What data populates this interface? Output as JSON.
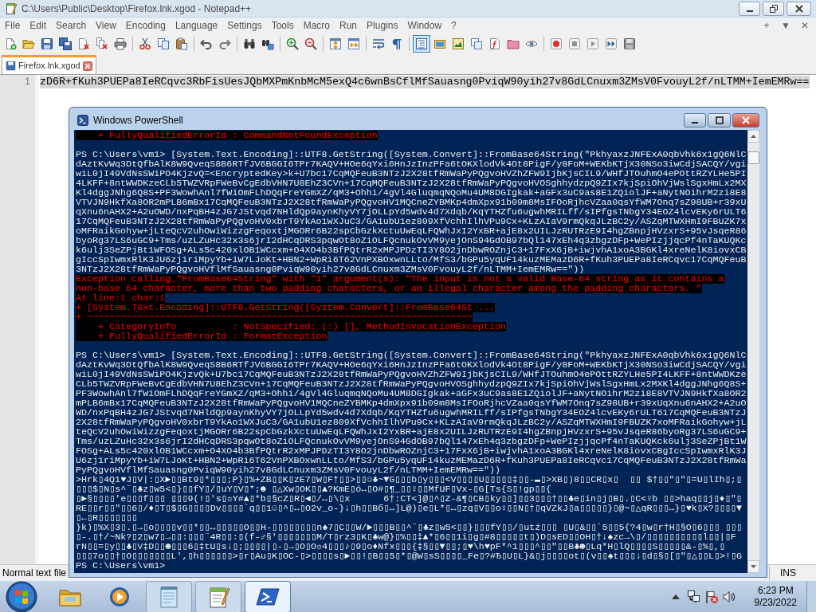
{
  "notepad": {
    "title": "C:\\Users\\Public\\Desktop\\Firefox.lnk.xgod - Notepad++",
    "menu": [
      "File",
      "Edit",
      "Search",
      "View",
      "Encoding",
      "Language",
      "Settings",
      "Tools",
      "Macro",
      "Run",
      "Plugins",
      "Window",
      "?"
    ],
    "menu_controls": [
      "+",
      "▼",
      "✕"
    ],
    "toolbar": [
      [
        {
          "kind": "new",
          "on": false
        },
        {
          "kind": "open",
          "on": false
        },
        {
          "kind": "save",
          "on": false
        },
        {
          "kind": "save_all",
          "on": false
        },
        {
          "kind": "close",
          "on": false
        },
        {
          "kind": "close_all",
          "on": false
        },
        {
          "kind": "print",
          "on": false
        }
      ],
      [
        {
          "kind": "cut",
          "on": false
        },
        {
          "kind": "copy",
          "on": false
        },
        {
          "kind": "paste",
          "on": false
        }
      ],
      [
        {
          "kind": "undo",
          "on": false
        },
        {
          "kind": "redo",
          "on": false
        }
      ],
      [
        {
          "kind": "find",
          "on": false
        },
        {
          "kind": "replace",
          "on": false
        }
      ],
      [
        {
          "kind": "zoom_in",
          "on": false
        },
        {
          "kind": "zoom_out",
          "on": false
        }
      ],
      [
        {
          "kind": "sync_vertical",
          "on": false
        },
        {
          "kind": "sync_horizontal",
          "on": false
        }
      ],
      [
        {
          "kind": "wrap",
          "on": false
        },
        {
          "kind": "show_all",
          "on": false
        }
      ],
      [
        {
          "kind": "indent_guide",
          "on": true
        },
        {
          "kind": "language",
          "on": false
        },
        {
          "kind": "doc_map",
          "on": false
        },
        {
          "kind": "doc_list",
          "on": false
        },
        {
          "kind": "function_list",
          "on": false
        },
        {
          "kind": "folder",
          "on": false
        },
        {
          "kind": "monitor",
          "on": false
        }
      ],
      [
        {
          "kind": "record",
          "on": false
        },
        {
          "kind": "stop",
          "on": false
        },
        {
          "kind": "play",
          "on": false
        },
        {
          "kind": "play_multi",
          "on": false
        },
        {
          "kind": "save_macro",
          "on": false
        }
      ]
    ],
    "tabs": [
      {
        "label": "Firefox.lnk.xgod",
        "selected": true
      }
    ],
    "lines": [
      {
        "number": "1",
        "text": "zD6R+fKuh3PUEPa8IeRCqvc3RbFisUesJQbMXPmKnbMcM5exQ4c6wnBsCflMfSauasng0PviqW90yih27v8GdLCnuxm3ZMsV0FvouyL2f/nLTMM+IemEMRw==",
        "selected": true
      }
    ],
    "status_bar": [
      "Normal text file",
      "INS"
    ]
  },
  "powershell": {
    "title": "Windows PowerShell",
    "lines": [
      {
        "kind": "error",
        "text": "    + FullyQualifiedErrorId : CommandNotFoundException"
      },
      {
        "kind": "blank"
      },
      {
        "kind": "output",
        "text": "PS C:\\Users\\vm1> [System.Text.Encoding]::UTF8.GetString([System.Convert]::FromBase64String(\"PkhyaxzJNFExA0qbVhk6x1gQ6NlC"
      },
      {
        "kind": "output",
        "text": "dAztKvWq3DtQfbAlK8W9QveqS8B6RTfJV6BGGI6TPr7KAQV+HOe6qYxi6HnJzInzPFa6tOKXlodVk4Ot8PigF/y8FoM+WEKbKTjX30NSo3iwCdjSACQY/vgi"
      },
      {
        "kind": "output",
        "text": "wiL0jI49VdNsSWiPO4KjzvQ=<EncryptedKey>k+U7bc17CqMQFeuB3NTzJ2X28tfRmWaPyPQgvoHVZhZFW9IjbKjsCIL9/WHfJTOuhmO4ePOttRZYLHe5PI"
      },
      {
        "kind": "output",
        "text": "4LKFF+8ntWWDKzeCLb5TWZVRpFWeBvCgEdbVHN7U8EhZ3CVn+17CqMQFeuB3NTzJ2X28tfRmWaPyPQgvoHVOSghhydzpQ9ZIx7kjSpiOhVjWslSgxHmLx2MX"
      },
      {
        "kind": "output",
        "text": "Kl4dggJNhg6Q8S+PF3WowhAnl7fWiOmFLhDQqFreYGmXZ/qM3+Ohhi/4gVl4GluqmqNQoMu4UM8DGIgkak+aGFx3uC9as8E1ZQiolJF+aNytNOihrM2zi8E8"
      },
      {
        "kind": "output",
        "text": "VTVJN9HkfXa8OR2mPLB6mBx17CqMQFeuB3NTzJ2X28tfRmWaPyPQgvoHV1MQCneZYBMKp4dmXpx91b09m8MsIFOoRjhcVZaa0qsYfWM7Onq7sZ98UB+r39xU"
      },
      {
        "kind": "output",
        "text": "qXnu6nAHX2+A2uOWD/nxPqBH4zJG7JStvqd7NHldQp9aynKhyVY7jOLLpYd5wdv4d7Xdqb/KqYTHZfu6ugwhMRILff/sIPfgsTNbgY34EOZ4lcvEKy6rULT6"
      },
      {
        "kind": "output",
        "text": "17CqMQFeuB3NTzJ2X28tfRmWaPyPQgvoHV0xbrT9YkAo1WXJuC3/GA1ubU1ez809XfVchhIlhVPu9Cx+KLzAIaV9rmQkqJLzBC2y/ASZqMTWXHmI9FBUZK7x"
      },
      {
        "kind": "output",
        "text": "oMFRaikGohyw+jLteQcV2uhOwiWizzgFeqoxtjMGORr6B22spCbGzkXctuUwEqLFQWhJxI2YxBR+ajE8x2UILJzRUTRzE9I4hgZBnpjHVzxrS+95vJsqeR86"
      },
      {
        "kind": "output",
        "text": "byoRg37LS6uGC9+Tms/uzLZuHc32x3s6jrI2dHCqDRS3pqwOt8oZiOLFQcnukOvVM9yejOnS94GdOB97bQl147xEh4q3zbgzDFp+WePIzjjqcPf4nTaKUQKc"
      },
      {
        "kind": "output",
        "text": "k6ulj3SeZPjBt1WFOSg+ALs5c420xlOB1WCcxm+O4XO4b3BfPQtrR2xMPJPDzTI3Y8O2jnDbwROZnjC3+17FxX6jB+iwjvhA1xoA3BGKl4xreNelK8iovxCB"
      },
      {
        "kind": "output",
        "text": "gIccSpIwmxRlK3JU6zj1riMpyYb+iW7LJoKt+HBN2+WpRi6T62VnPXBOxwnLLto/MfS3/bGPu5yqUF14kuzMEMazD6R+fKuh3PUEPa8IeRCqvc17CqMQFeuB"
      },
      {
        "kind": "output",
        "text": "3NTzJ2X28tfRmWaPyPQgvoHVflMfSauasng0PviqW90yih27v8GdLCnuxm3ZMsV0FvouyL2f/nLTMM+IemEMRw==\"))"
      },
      {
        "kind": "error",
        "text": "Exception calling \"FromBase64String\" with \"1\" argument(s): \"The input is not a valid Base-64 string as it contains a"
      },
      {
        "kind": "error",
        "text": "non-base 64 character, more than two padding characters, or an illegal character among the padding characters. \""
      },
      {
        "kind": "error",
        "text": "At line:1 char:1"
      },
      {
        "kind": "error",
        "text": "+ [System.Text.Encoding]::UTF8.GetString([System.Convert]::FromBase64St ..."
      },
      {
        "kind": "error",
        "text": "+ ~~~~~~~~~~~~~~~~~~~~~~~~~~~~~~~~~~~~~~~~~~~~~~~~~~~~~~~~~~~~~~~~~~~~~"
      },
      {
        "kind": "error",
        "text": "    + CategoryInfo          : NotSpecified: (:) [], MethodInvocationException"
      },
      {
        "kind": "error",
        "text": "    + FullyQualifiedErrorId : FormatException"
      },
      {
        "kind": "blank"
      },
      {
        "kind": "output",
        "text": "PS C:\\Users\\vm1> [System.Text.Encoding]::UTF8.GetString([System.Convert]::FromBase64String(\"PkhyaxzJNFExA0qbVhk6x1gQ6NlC"
      },
      {
        "kind": "output",
        "text": "dAztKvWq3DtQfbAlK8W9QveqS8B6RTfJV6BGGI6TPr7KAQV+HOe6qYxi6HnJzInzPFa6tOKXlodVk4Ot8PigF/y8FoM+WEKbKTjX30NSo3iwCdjSACQY/vgi"
      },
      {
        "kind": "output",
        "text": "wiL0jI49VdNsSWiPO4KjzvQk+U7bc17CqMQFeuB3NTzJ2X28tfRmWaPyPQgvoHVZhZFW9IjbKjsCIL9/WHfJTOuhmO4ePOttRZYLHe5PI4LKFF+8ntWWDKze"
      },
      {
        "kind": "output",
        "text": "CLb5TWZVRpFWeBvCgEdbVHN7U8EhZ3CVn+17CqMQFeuB3NTzJ2X28tfRmWaPyPQgvoHVOSghhydzpQ9ZIx7kjSpiOhVjWslSgxHmLx2MXKl4dggJNhg6Q8S+"
      },
      {
        "kind": "output",
        "text": "PF3WowhAnl7fWiOmFLhDQqFreYGmXZ/qM3+Ohhi/4gVl4GluqmqNQoMu4UM8DGIgkak+aGFx3uC9as8E1ZQiolJF+aNytNOihrM2zi8E8VTVJN9HkfXa8OR2"
      },
      {
        "kind": "output",
        "text": "mPLB6mBx17CqMQFeuB3NTzJ2X28tfRmWaPyPQgvoHV1MQCneZYBMKp4dmXpx91b09m8MsIFOoRjhcVZaa0qsYfWM7Onq7sZ98UB+r39xUqXnu6nAHX2+A2uO"
      },
      {
        "kind": "output",
        "text": "WD/nxPqBH4zJG7JStvqd7NHldQp9aynKhyVY7jOLLpYd5wdv4d7Xdqb/KqYTHZfu6ugwhMRILff/sIPfgsTNbgY34EOZ4lcvEKy6rULT617CqMQFeuB3NTzJ"
      },
      {
        "kind": "output",
        "text": "2X28tfRmWaPyPQgvoHV0xbrT9YkAo1WXJuC3/GA1ubU1ez809XfVchhIlhVPu9Cx+KLzAIaV9rmQkqJLzBC2y/ASZqMTWXHmI9FBUZK7xoMFRaikGohyw+jL"
      },
      {
        "kind": "output",
        "text": "teQcV2uhOwiWizzgFeqoxtjMGORr6B22spCbGzkXctuUwEqLFQWhJxI2YxBR+ajE8x2UILJzRUTRzE9I4hgZBnpjHVzxrS+95vJsqeR86byoRg37LS6uGC9+"
      },
      {
        "kind": "output",
        "text": "Tms/uzLZuHc32x3s6jrI2dHCqDRS3pqwOt8oZiOLFQcnukOvVM9yejOnS94GdOB97bQl147xEh4q3zbgzDFp+WePIzjjqcPf4nTaKUQKck6ulj3SeZPjBt1W"
      },
      {
        "kind": "output",
        "text": "FOSg+ALs5c420xlOB1WCcxm+O4XO4b3BfPQtrR2xMPJPDzTI3Y8O2jnDbwROZnjC3+17FxX6jB+iwjvhA1xoA3BGKl4xreNelK8iovxCBgIccSpIwmxRlK3J"
      },
      {
        "kind": "output",
        "text": "U6zj1riMpyYb+iW7LJoKt+HBN2+WpRi6T62VnPXBOxwnLLto/MfS3/bGPu5yqUF14kuzMEMazD6R+fKuh3PUEPa8IeRCqvc17CqMQFeuB3NTzJ2X28tfRmWa"
      },
      {
        "kind": "output",
        "text": "PyPQgvoHVflMfSauasng0PviqW90yih27v8GdLCnuxm3ZMsV0FvouyL2f/nLTMM+IemEMRw==\"))"
      },
      {
        "kind": "output",
        "text": ">Hrk▯4Q1♥J▯V|:▯X►▯▯Bt9▯*▯▯▯;P}▯%+ZB▯▯K▯zE7▯W▯F†▯▯>▯▯☺♣~▼G▯▯▯b▯y▯▯▯<V▯▯▯▯U▯▯▯▯▯‡▯▯-▬▯>XB▯)8▯▯CR▯x▯  ▯▯ $†▯▯\"▯\"▯=U▯lIh▯;▯"
      },
      {
        "kind": "output",
        "text": "▯▯▯$▯N▯s^¨▯♣z▯w5<▯}▯▯fY▯/▯uY▯V▯*;☻ ▯△Xw▯OK▯▯▲?KmE▯ó↔▯O#▯¶_▯▯♀▯▯MfUF▯Vx-▯G[Ts{S▯!gp▯▯{"
      },
      {
        "kind": "output",
        "text": "▯►§▯▯▯▯'e▯▯▯f▯▯▯ ▯▯▯9(!▯'s▯☼Y#▲▯*b▯§cZ▯R▯◄▯/↔▯\\▯x      6†:CT<]@▯^▯Z-&¶▯CB▯ky▯▯]▯▯3▯▯▯†▯▯♣e▯in▯j▯B▯.▯C<♀b ▯▯>haq▯▯j▯♦▯\"▯"
      },
      {
        "kind": "output",
        "text": "RE▯▯r▯▯\"▯▯6▯/♦▯T▯$▯G▯▯▯▯Dv▯▯▯▯`q▯▯1☺▯^▯↔▯O2v_o-}↓▯h▯▯Bб▯↔]L@)▯e▯L*▯↔▯zq▯V▯▯o♀▯▯N▯†▯qVZkJ▯a▯▯▯▯▯}▯@~▯△qR▯▯▯↔}▯♥k▯X?▯▯▯▯▼"
      },
      {
        "kind": "output",
        "text": "▯←▯R▯▯▯▯▯▯▯"
      },
      {
        "kind": "output",
        "text": "}k)▯%X▯3▯.▯→▯o▯▯▯▯v▯▯*▯▯↔▯▯▯▯▯O▯▯H-▯▯▯▯▯▯▯▯n♠7▯C▯▯W/►▯▯▯B▯▯^¨▯♣z▯w5<▯▯}▯▯▯fY▯▯/▯utź▯▯▯ ▯U▯&▯▯`5▯▯5{?4▯w▯r†H▯§O▯6▯▯▯ ▯▯▯"
      },
      {
        "kind": "output",
        "text": "▯-.▯†/~Nk?▯2▯w7▯→▯▯:▯▯▯¨4R▯▯:▯(f-♂§'▯▯▯▯▯▯▯M/T▯rz3▯K▯♣w@}▯%▯▯‡▲*▯6▯▯1i▯g▯#8▯▯▯▯▯t▯)D▯sED▯▯OH▯†↓♠zc→\\▯/▯▯▯▯▯▯▯▯▯▯l▯▯|▯F"
      },
      {
        "kind": "output",
        "text": "rN▯▯=▯y▯▯♣▯V‡D▯▯☻▯▯▯6▯‡tU▯s↓▯;▯▯▯▯|▯-▯→▯O▯O☼4▯▯▯♪▯9▯o♦Nfx▯▯▯{‡§▯▯▼▯▯;▯♥\\h♥pF*^1▯▯▯^▯▯\"▯▯B♣☻▯Lq*H▯lQ▯▯▯▯S▯▯▯▯▯&-▯%▯,▯"
      },
      {
        "kind": "output",
        "text": "▯▯▯7o▯▯†▯O▯▯▯▯▯▯▯L',▯h▯▯▯▯▯▯>▯r▯Au▯K▯OC-▯>▯▯▯▯s▯►▯▯!▯B▯▯5▯*▯@W▯sS▯▯▯▯_Fe▯?#Ђ▯U▯L}&▯j▯▯▯▯ot▯(v▯▯♠t▯▯▯↓▯d▯§▯[▯\"▯△▯▯L▯>!▯G"
      },
      {
        "kind": "output",
        "text": "PS C:\\Users\\vm1>"
      }
    ]
  },
  "taskbar": {
    "apps": [
      {
        "kind": "explorer",
        "running": false,
        "active": false
      },
      {
        "kind": "media_player",
        "running": false,
        "active": false
      },
      {
        "kind": "notepad",
        "running": true,
        "active": false
      },
      {
        "kind": "notepadpp",
        "running": true,
        "active": false
      },
      {
        "kind": "powershell",
        "running": true,
        "active": true
      }
    ],
    "clock": {
      "time": "6:23 PM",
      "date": "9/23/2022"
    }
  }
}
